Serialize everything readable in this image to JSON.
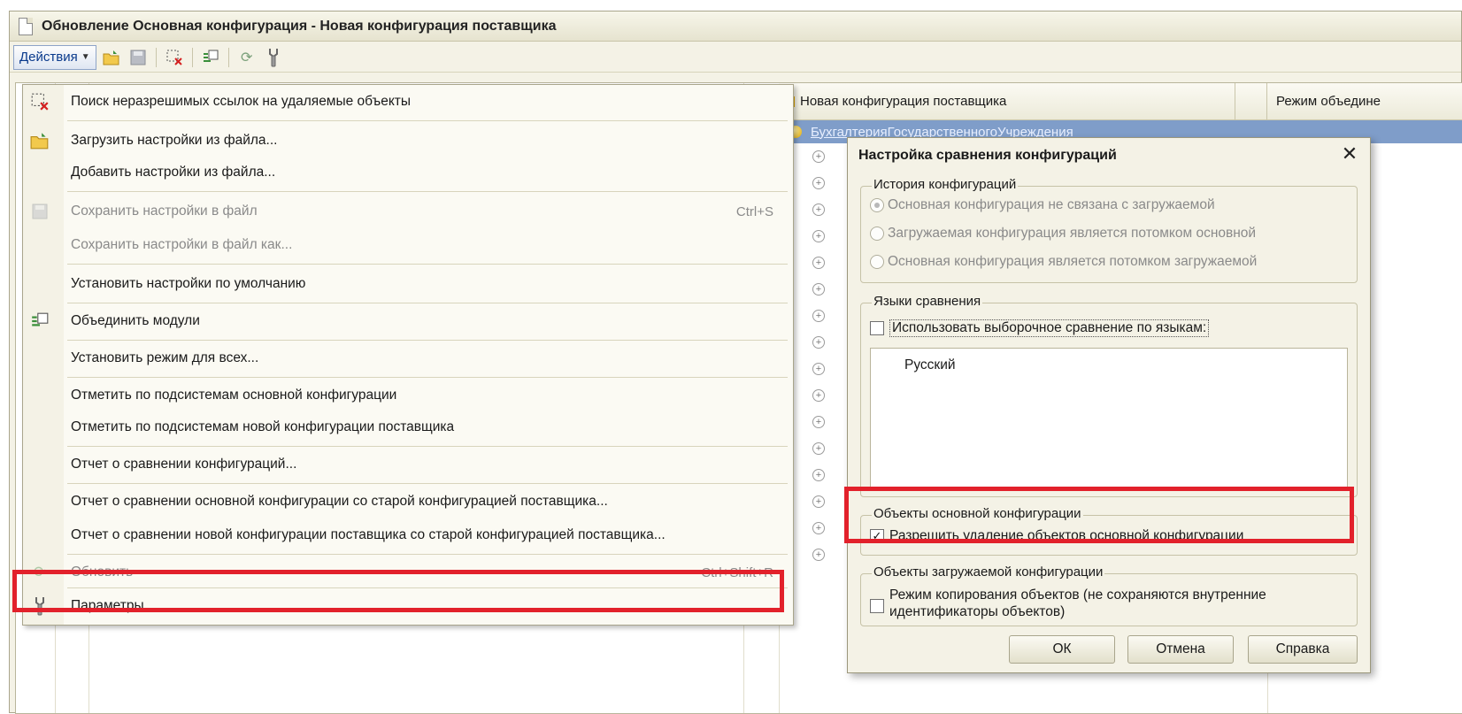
{
  "window": {
    "title": "Обновление Основная конфигурация - Новая конфигурация поставщика"
  },
  "toolbar": {
    "actions_label": "Действия"
  },
  "tree": {
    "columns": [
      "Новая конфигурация поставщика",
      "Режим объедине"
    ],
    "selected_row": "БухгалтерияГосударственногоУчреждения"
  },
  "menu": {
    "items": [
      {
        "label": "Поиск неразрешимых ссылок на удаляемые объекты",
        "shortcut": "",
        "icon": "find-unresolved-links-icon",
        "disabled": false
      },
      {
        "label": "Загрузить настройки из файла...",
        "shortcut": "",
        "icon": "open-folder-icon",
        "disabled": false
      },
      {
        "label": "Добавить настройки из файла...",
        "shortcut": "",
        "icon": "",
        "disabled": false
      },
      {
        "label": "Сохранить настройки в файл",
        "shortcut": "Ctrl+S",
        "icon": "save-disk-icon",
        "disabled": true
      },
      {
        "label": "Сохранить настройки в файл как...",
        "shortcut": "",
        "icon": "",
        "disabled": true
      },
      {
        "label": "Установить настройки по умолчанию",
        "shortcut": "",
        "icon": "",
        "disabled": false
      },
      {
        "label": "Объединить модули",
        "shortcut": "",
        "icon": "merge-modules-icon",
        "disabled": false
      },
      {
        "label": "Установить режим для всех...",
        "shortcut": "",
        "icon": "",
        "disabled": false
      },
      {
        "label": "Отметить по подсистемам основной конфигурации",
        "shortcut": "",
        "icon": "",
        "disabled": false
      },
      {
        "label": "Отметить по подсистемам новой конфигурации поставщика",
        "shortcut": "",
        "icon": "",
        "disabled": false
      },
      {
        "label": "Отчет о сравнении конфигураций...",
        "shortcut": "",
        "icon": "",
        "disabled": false
      },
      {
        "label": "Отчет о сравнении основной конфигурации со старой конфигурацией поставщика...",
        "shortcut": "",
        "icon": "",
        "disabled": false
      },
      {
        "label": "Отчет о сравнении новой конфигурации поставщика со старой конфигурацией поставщика...",
        "shortcut": "",
        "icon": "",
        "disabled": false
      },
      {
        "label": "Обновить",
        "shortcut": "Ctrl+Shift+R",
        "icon": "refresh-icon",
        "disabled": true
      },
      {
        "label": "Параметры...",
        "shortcut": "",
        "icon": "wrench-icon",
        "disabled": false
      }
    ]
  },
  "dialog": {
    "title": "Настройка сравнения конфигураций",
    "history": {
      "title": "История конфигураций",
      "options": [
        "Основная конфигурация не связана с загружаемой",
        "Загружаемая конфигурация является потомком основной",
        "Основная конфигурация является потомком загружаемой"
      ],
      "selected_index": 0
    },
    "languages": {
      "title": "Языки сравнения",
      "checkbox_label": "Использовать выборочное сравнение по языкам:",
      "checked": false,
      "list": [
        "Русский"
      ]
    },
    "main_objects": {
      "title": "Объекты основной конфигурации",
      "checkbox_label": "Разрешить удаление объектов основной конфигурации",
      "checked": true
    },
    "loaded_objects": {
      "title": "Объекты загружаемой конфигурации",
      "checkbox_line1": "Режим копирования объектов (не сохраняются внутренние",
      "checkbox_line2": "идентификаторы объектов)",
      "checked": false
    },
    "buttons": {
      "ok": "ОК",
      "cancel": "Отмена",
      "help": "Справка"
    }
  },
  "colors": {
    "highlight": "#e2212b",
    "selection": "#7f9dc9"
  }
}
